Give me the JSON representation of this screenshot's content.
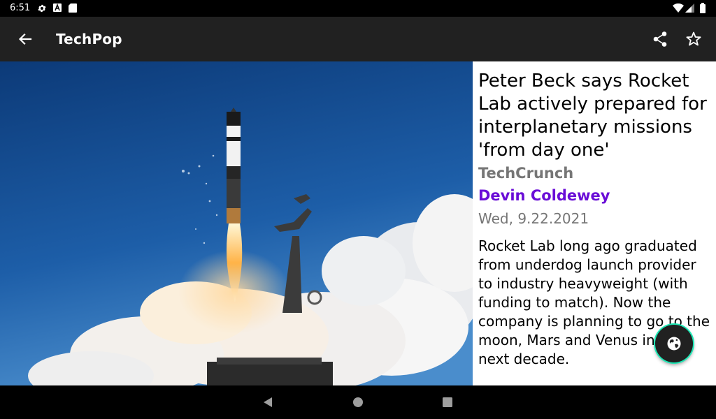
{
  "status_bar": {
    "time": "6:51",
    "left_icons": [
      "settings-icon",
      "text-a-icon",
      "sd-card-icon"
    ],
    "right_icons": [
      "wifi-icon",
      "signal-icon",
      "battery-icon"
    ]
  },
  "app_bar": {
    "title": "TechPop",
    "background": "#212121",
    "actions": [
      "back-arrow-icon",
      "share-icon",
      "star-outline-icon"
    ]
  },
  "hero_image": {
    "description_icon": "rocket-launch-photo"
  },
  "article": {
    "headline": "Peter Beck says Rocket Lab actively prepared for interplanetary missions 'from day one'",
    "source": "TechCrunch",
    "author": "Devin Coldewey",
    "date": "Wed, 9.22.2021",
    "summary": "Rocket Lab long ago graduated from underdog launch provider to industry heavyweight (with funding to match). Now the company is planning to go to the moon, Mars and Venus in the next decade.",
    "author_color": "#6a0dd7",
    "meta_color": "#767676"
  },
  "fab": {
    "icon": "globe-icon",
    "ring_color": "#1de9b6"
  },
  "nav_bar": {
    "buttons": [
      "back-triangle-icon",
      "home-circle-icon",
      "recents-square-icon"
    ]
  }
}
